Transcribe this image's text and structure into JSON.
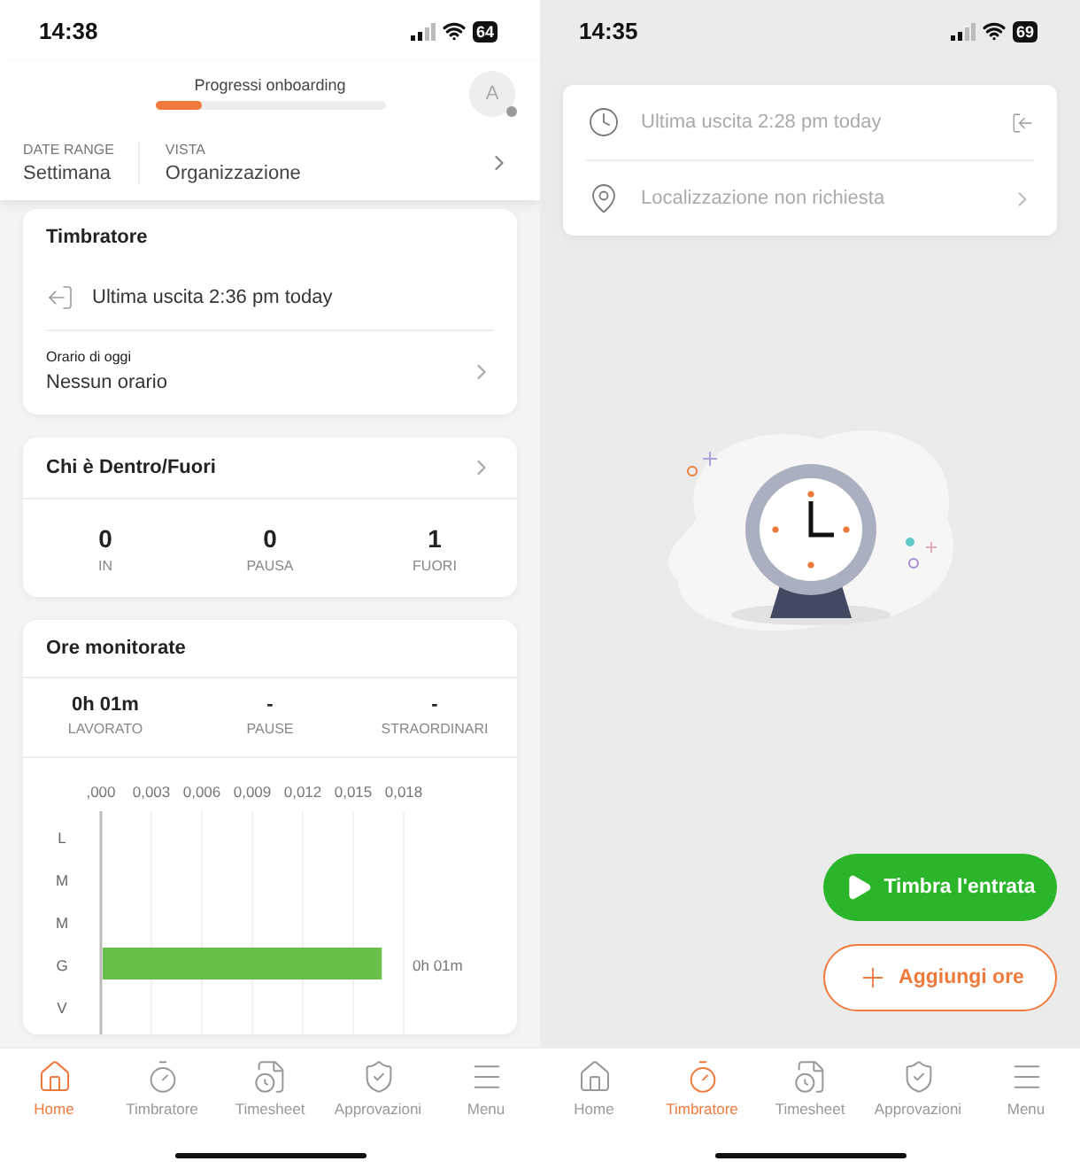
{
  "home_screen": {
    "status_bar": {
      "time": "14:38",
      "battery": "64"
    },
    "header": {
      "progress_title": "Progressi onboarding",
      "level": 0.2,
      "avatar": "A",
      "date_range_label": "DATE RANGE",
      "date_range": "Settimana",
      "view_label": "VISTA",
      "view": "Organizzazione"
    },
    "timbratore_card": {
      "title": "Timbratore",
      "last_exit": "Ultima uscita 2:36 pm today",
      "schedule_label": "Orario di oggi",
      "schedule": "Nessun orario"
    },
    "presence_card": {
      "title": "Chi è Dentro/Fuori",
      "stats": [
        {
          "value": "0",
          "label": "IN"
        },
        {
          "value": "0",
          "label": "PAUSA"
        },
        {
          "value": "1",
          "label": "FUORI"
        }
      ]
    },
    "hours_card": {
      "title": "Ore monitorate",
      "stats": [
        {
          "value": "0h 01m",
          "label": "LAVORATO"
        },
        {
          "value": "-",
          "label": "PAUSE"
        },
        {
          "value": "-",
          "label": "STRAORDINARI"
        }
      ],
      "chart_data": {
        "type": "bar",
        "orientation": "horizontal",
        "grid": true,
        "categories": [
          "L",
          "M",
          "M",
          "G",
          "V"
        ],
        "values": [
          null,
          null,
          null,
          0.0167,
          null
        ],
        "xlim": [
          0,
          0.018
        ],
        "xticks": [
          {
            "value": 0,
            "label": ",000"
          },
          {
            "value": 0.003,
            "label": "0,003"
          },
          {
            "value": 0.006,
            "label": "0,006"
          },
          {
            "value": 0.009,
            "label": "0,009"
          },
          {
            "value": 0.012,
            "label": "0,012"
          },
          {
            "value": 0.015,
            "label": "0,015"
          },
          {
            "value": 0.018,
            "label": "0,018"
          }
        ],
        "value_labels": [
          null,
          null,
          null,
          "0h 01m",
          null
        ]
      }
    },
    "nav": [
      {
        "label": "Home",
        "selected": true
      },
      {
        "label": "Timbratore",
        "selected": false
      },
      {
        "label": "Timesheet",
        "selected": false
      },
      {
        "label": "Approvazioni",
        "selected": false
      },
      {
        "label": "Menu",
        "selected": false
      }
    ]
  },
  "timbratore_screen": {
    "status_bar": {
      "time": "14:35",
      "battery": "69"
    },
    "info_card": {
      "last_exit": "Ultima uscita 2:28 pm today",
      "location": "Localizzazione non richiesta"
    },
    "buttons": [
      {
        "label": "Timbra l'entrata",
        "kind": "primary"
      },
      {
        "label": "Aggiungi ore",
        "kind": "secondary"
      }
    ],
    "nav": [
      {
        "label": "Home",
        "selected": false
      },
      {
        "label": "Timbratore",
        "selected": true
      },
      {
        "label": "Timesheet",
        "selected": false
      },
      {
        "label": "Approvazioni",
        "selected": false
      },
      {
        "label": "Menu",
        "selected": false
      }
    ]
  }
}
